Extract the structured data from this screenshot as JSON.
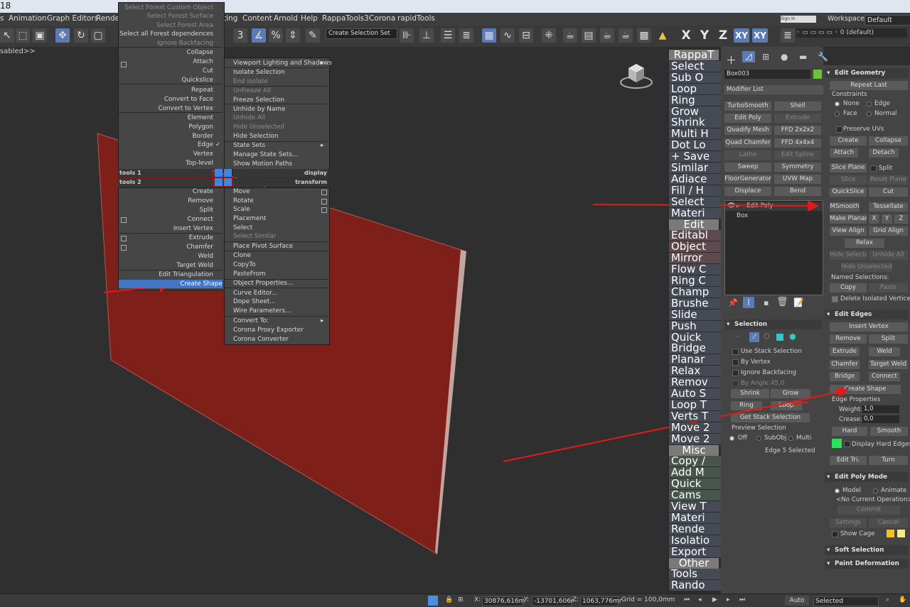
{
  "tabstrip": {
    "number": "18"
  },
  "menubar": {
    "items": [
      "s",
      "Animation",
      "Graph Editors",
      "Render",
      "ting",
      "Content",
      "Arnold",
      "Help",
      "RappaTools3",
      "Corona",
      "rapidTools"
    ]
  },
  "toolbar": {
    "selection_set": "Create Selection Set",
    "axes": [
      "X",
      "Y",
      "Z",
      "XY",
      "XY"
    ],
    "layer": "0 (default)",
    "workspaces_label": "Workspaces:",
    "workspaces_value": "Default",
    "sign_in": "Sign In"
  },
  "viewport": {
    "label": "sabled>>",
    "plane_color": "#7e1f1a",
    "accent": "#4275c5"
  },
  "quad_left_top": [
    "Select Forest Custom Object",
    "Select Forest Surface",
    "Select Forest Area",
    "Select all Forest dependences",
    "Ignore Backfacing",
    "Collapse",
    "Attach",
    "Cut",
    "Quickslice",
    "Repeat",
    "Convert to Face",
    "Convert to Vertex",
    "Element",
    "Polygon",
    "Border",
    "Edge",
    "Vertex",
    "Top-level"
  ],
  "quad_right_top": [
    "Viewport Lighting and Shadows",
    "Isolate Selection",
    "End Isolate",
    "Unfreeze All",
    "Freeze Selection",
    "Unhide by Name",
    "Unhide All",
    "Hide Unselected",
    "Hide Selection",
    "State Sets",
    "Manage State Sets...",
    "Show Motion Paths"
  ],
  "quad_headers": {
    "tools1": "tools 1",
    "display": "display",
    "tools2": "tools 2",
    "transform": "transform"
  },
  "quad_left_bottom": [
    "Create",
    "Remove",
    "Split",
    "Connect",
    "Insert Vertex",
    "Extrude",
    "Chamfer",
    "Weld",
    "Target Weld",
    "Edit Triangulation",
    "Create Shape"
  ],
  "quad_right_bottom": [
    "Move",
    "Rotate",
    "Scale",
    "Placement",
    "Select",
    "Select Similar",
    "Place Pivot Surface",
    "Clone",
    "CopyTo",
    "PasteFrom",
    "Object Properties...",
    "Curve Editor...",
    "Dope Sheet...",
    "Wire Parameters...",
    "Convert To:",
    "Corona Proxy Exporter",
    "Corona Converter"
  ],
  "toollist": [
    "RappaT",
    "Select",
    "Sub O",
    "Loop",
    "Ring",
    "Grow",
    "Shrink",
    "Multi H",
    "Dot Lo",
    "+ Save",
    "Similar",
    "Adiace",
    "Fill / H",
    "Select",
    "Materi",
    "Edit",
    "Editabl",
    "Object",
    "Mirror",
    "Flow C",
    "Ring C",
    "Champ",
    "Brushe",
    "Slide",
    "Push",
    "Quick",
    "Bridge",
    "Planar",
    "Relax",
    "Remov",
    "Auto S",
    "Loop T",
    "Verts T",
    "Move 2",
    "Move 2",
    "Misc",
    "Copy /",
    "Add M",
    "Quick",
    "Cams",
    "View T",
    "Materi",
    "Rende",
    "Isolatio",
    "Export",
    "Other",
    "Tools",
    "Rando"
  ],
  "cmd": {
    "object_name": "Box003",
    "object_color": "#6dc23a",
    "modifier_list": "Modifier List",
    "modifiers": [
      [
        "TurboSmooth",
        "Shell"
      ],
      [
        "Edit Poly",
        "Extrude"
      ],
      [
        "Quadify Mesh",
        "FFD 2x2x2"
      ],
      [
        "Quad Chamfer",
        "FFD 4x4x4"
      ],
      [
        "Lathe",
        "Edit Spline"
      ],
      [
        "Sweep",
        "Symmetry"
      ],
      [
        "FloorGenerator",
        "UVW Map"
      ],
      [
        "Displace",
        "Bend"
      ]
    ],
    "stack": [
      "Edit Poly",
      "Box"
    ],
    "selection": {
      "title": "Selection",
      "use_stack": "Use Stack Selection",
      "by_vertex": "By Vertex",
      "ignore_backfacing": "Ignore Backfacing",
      "by_angle": "By Angle:",
      "by_angle_value": "45,0",
      "shrink": "Shrink",
      "grow": "Grow",
      "ring": "Ring",
      "loop": "Loop",
      "get_stack": "Get Stack Selection",
      "preview": "Preview Selection",
      "off": "Off",
      "subobj": "SubObj",
      "multi": "Multi",
      "status": "Edge 5 Selected"
    }
  },
  "edit_geometry": {
    "title": "Edit Geometry",
    "repeat_last": "Repeat Last",
    "constraints": "Constraints",
    "none": "None",
    "edge": "Edge",
    "face": "Face",
    "normal": "Normal",
    "preserve_uvs": "Preserve UVs",
    "create": "Create",
    "collapse": "Collapse",
    "attach": "Attach",
    "detach": "Detach",
    "slice_plane": "Slice Plane",
    "split": "Split",
    "slice": "Slice",
    "reset_plane": "Reset Plane",
    "quickslice": "QuickSlice",
    "cut": "Cut",
    "msmooth": "MSmooth",
    "tessellate": "Tessellate",
    "make_planar": "Make Planar",
    "x": "X",
    "y": "Y",
    "z": "Z",
    "view_align": "View Align",
    "grid_align": "Grid Align",
    "relax": "Relax",
    "hide_selected": "Hide Selected",
    "unhide_all": "Unhide All",
    "hide_unselected": "Hide Unselected",
    "named_selections": "Named Selections:",
    "copy": "Copy",
    "paste": "Paste",
    "delete_isolated": "Delete Isolated Vertices"
  },
  "edit_edges": {
    "title": "Edit Edges",
    "insert_vertex": "Insert Vertex",
    "remove": "Remove",
    "split": "Split",
    "extrude": "Extrude",
    "weld": "Weld",
    "chamfer": "Chamfer",
    "target_weld": "Target Weld",
    "bridge": "Bridge",
    "connect": "Connect",
    "create_shape": "Create Shape",
    "edge_properties": "Edge Properties",
    "weight": "Weight:",
    "weight_value": "1,0",
    "crease": "Crease:",
    "crease_value": "0,0",
    "hard": "Hard",
    "smooth": "Smooth",
    "display_hard": "Display Hard Edges",
    "hard_color": "#2ee05a",
    "edit_tri": "Edit Tri.",
    "turn": "Turn"
  },
  "edit_poly_mode": {
    "title": "Edit Poly Mode",
    "model": "Model",
    "animate": "Animate",
    "current_op": "<No Current Operation>",
    "commit": "Commit",
    "settings": "Settings",
    "cancel": "Cancel",
    "show_cage": "Show Cage",
    "cage_color1": "#f4c21c",
    "cage_color2": "#f0ec8a"
  },
  "soft_selection": {
    "title": "Soft Selection"
  },
  "paint_deformation": {
    "title": "Paint Deformation"
  },
  "status": {
    "x_label": "X:",
    "x": "30876,616m",
    "y_label": "Y:",
    "y": "-13701,606r",
    "z_label": "Z:",
    "z": "1063,776mr",
    "grid": "Grid = 100,0mm",
    "auto": "Auto",
    "selected": "Selected"
  }
}
